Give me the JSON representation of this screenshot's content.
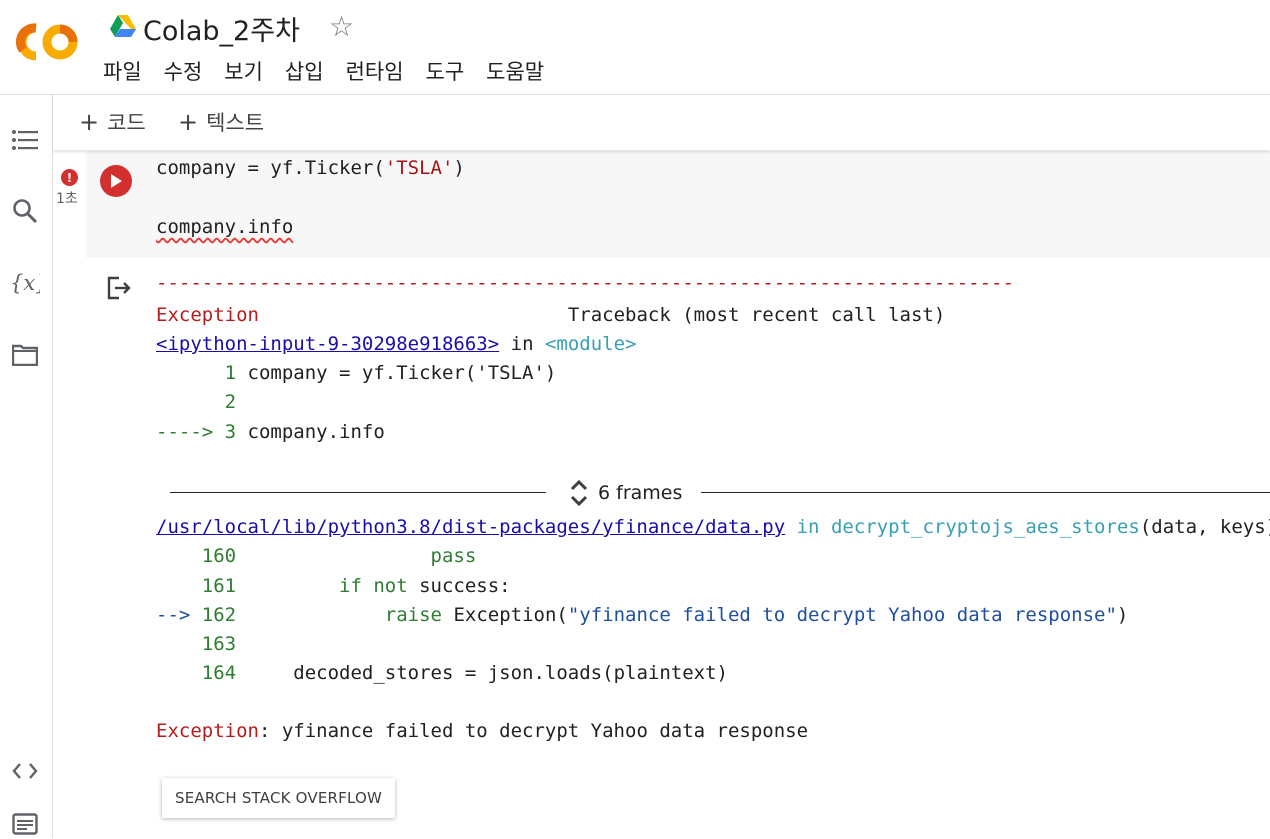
{
  "header": {
    "title": "Colab_2주차",
    "menu": [
      "파일",
      "수정",
      "보기",
      "삽입",
      "런타임",
      "도구",
      "도움말"
    ]
  },
  "toolbar": {
    "add_code_label": "코드",
    "add_text_label": "텍스트"
  },
  "cell": {
    "exec_time": "1초",
    "code_line1_pre": "company = yf.Ticker(",
    "code_line1_str": "'TSLA'",
    "code_line1_post": ")",
    "code_line3": "company.info"
  },
  "output": {
    "dashes": "---------------------------------------------------------------------------",
    "exc_name": "Exception",
    "traceback_header": "Traceback (most recent call last)",
    "input_link": "<ipython-input-9-30298e918663>",
    "in_word": "in",
    "module": "<module>",
    "tb1": [
      {
        "prefix": "      1 ",
        "text": "company = yf.Ticker('TSLA')"
      },
      {
        "prefix": "      2 ",
        "text": ""
      },
      {
        "prefix": "----> 3 ",
        "text": "company.info"
      }
    ],
    "frames_label": "6 frames",
    "file_link": "/usr/local/lib/python3.8/dist-packages/yfinance/data.py",
    "func_name": "decrypt_cryptojs_aes_stores",
    "func_args": "(data, keys)",
    "tb2": {
      "l160_num": "    160 ",
      "l160_code": "                pass",
      "l161_num": "    161 ",
      "l161_kw": "        if not",
      "l161_rest": " success:",
      "l162_arrow": "--> ",
      "l162_num": "162 ",
      "l162_kw": "            raise",
      "l162_rest_pre": " Exception(",
      "l162_str": "\"yfinance failed to decrypt Yahoo data response\"",
      "l162_rest_post": ")",
      "l163_num": "    163 ",
      "l164_num": "    164 ",
      "l164_code": "    decoded_stores = json.loads(plaintext)"
    },
    "final_exc_name": "Exception",
    "final_exc_msg": ": yfinance failed to decrypt Yahoo data response",
    "so_button": "SEARCH STACK OVERFLOW"
  },
  "colors": {
    "run_button": "#d32f2f",
    "error_red": "#b71c1c",
    "link_blue": "#1a0dab",
    "line_number_green": "#2e7d32"
  },
  "icons": [
    "colab-logo",
    "drive-icon",
    "star-icon",
    "toc-icon",
    "search-icon",
    "variables-icon",
    "files-icon",
    "code-snippets-icon",
    "terminal-icon",
    "run-icon",
    "error-icon",
    "output-icon",
    "frames-toggle-icon"
  ]
}
